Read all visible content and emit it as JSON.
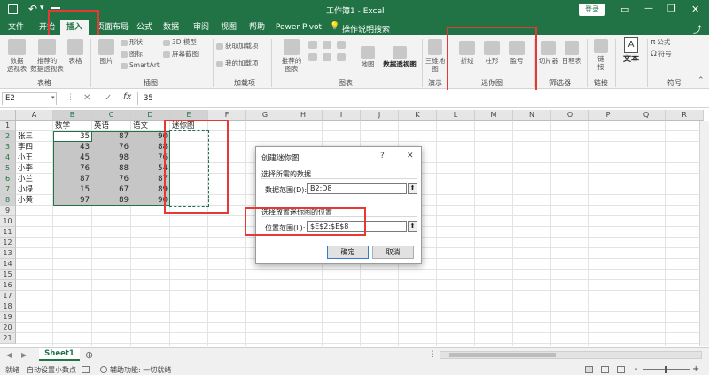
{
  "titlebar": {
    "qat_undo": "↶",
    "qat_dropdown": "▾",
    "title": "工作簿1 - Excel",
    "login": "登录",
    "ribbon_opts": "▭",
    "minimize": "—",
    "restore": "❐",
    "close": "✕"
  },
  "tabs": [
    {
      "label": "文件"
    },
    {
      "label": "开始"
    },
    {
      "label": "插入"
    },
    {
      "label": "页面布局"
    },
    {
      "label": "公式"
    },
    {
      "label": "数据"
    },
    {
      "label": "审阅"
    },
    {
      "label": "视图"
    },
    {
      "label": "帮助"
    },
    {
      "label": "Power Pivot"
    }
  ],
  "tell_me": {
    "icon": "💡",
    "label": "操作说明搜索"
  },
  "share": "⤴",
  "ribbon": {
    "table_group": {
      "pivot": "数据\n透视表",
      "recommended_pivot": "推荐的\n数据透视表",
      "table": "表格",
      "label": "表格"
    },
    "illus_group": {
      "pictures": "图片",
      "shapes": "形状",
      "icons": "图标",
      "model3d": "3D 模型",
      "smartart": "SmartArt",
      "screenshot": "屏幕截图",
      "label": "插图"
    },
    "addins_group": {
      "get": "获取加载项",
      "my": "我的加载项",
      "label": "加载项"
    },
    "charts_group": {
      "recommended": "推荐的\n图表",
      "maps": "地图",
      "pivotchart": "数据透视图",
      "label": "图表"
    },
    "tours_group": {
      "map3d": "三维地\n图",
      "label": "演示"
    },
    "sparkline_group": {
      "line": "折线",
      "column": "柱形",
      "winloss": "盈亏",
      "label": "迷你图"
    },
    "filter_group": {
      "slicer": "切片器",
      "timeline": "日程表",
      "label": "筛选器"
    },
    "links_group": {
      "link": "链\n接",
      "label": "链接"
    },
    "text_group": {
      "text": "文本",
      "label": ""
    },
    "symbols_group": {
      "equation": "公式",
      "symbol": "符号",
      "label": "符号"
    },
    "collapse": "⌃"
  },
  "formula_bar": {
    "name_box": "E2",
    "cancel": "✕",
    "enter": "✓",
    "fx": "fx",
    "value": "35"
  },
  "sheet": {
    "columns": [
      "A",
      "B",
      "C",
      "D",
      "E",
      "F",
      "G",
      "H",
      "I",
      "J",
      "K",
      "L",
      "M",
      "N",
      "O",
      "P",
      "Q",
      "R"
    ],
    "rows": [
      "1",
      "2",
      "3",
      "4",
      "5",
      "6",
      "7",
      "8",
      "9",
      "10",
      "11",
      "12",
      "13",
      "14",
      "15",
      "16",
      "17",
      "18",
      "19",
      "20",
      "21"
    ],
    "headers": [
      "数学",
      "英语",
      "语文",
      "迷你图"
    ],
    "data": [
      {
        "name": "张三",
        "math": "35",
        "english": "87",
        "chinese": "90"
      },
      {
        "name": "李四",
        "math": "43",
        "english": "76",
        "chinese": "88"
      },
      {
        "name": "小王",
        "math": "45",
        "english": "98",
        "chinese": "76"
      },
      {
        "name": "小李",
        "math": "76",
        "english": "88",
        "chinese": "54"
      },
      {
        "name": "小兰",
        "math": "87",
        "english": "76",
        "chinese": "87"
      },
      {
        "name": "小绿",
        "math": "15",
        "english": "67",
        "chinese": "89"
      },
      {
        "name": "小黄",
        "math": "97",
        "english": "89",
        "chinese": "90"
      }
    ]
  },
  "dialog": {
    "title": "创建迷你图",
    "help": "?",
    "close": "✕",
    "section1": "选择所需的数据",
    "data_range_label": "数据范围(D):",
    "data_range_value": "B2:D8",
    "section2": "选择放置迷你图的位置",
    "location_label": "位置范围(L):",
    "location_value": "$E$2:$E$8",
    "picker": "⬆",
    "ok": "确定",
    "cancel": "取消"
  },
  "sheet_tabs": {
    "prev": "◀",
    "next": "▶",
    "tab": "Sheet1",
    "add": "⊕",
    "more": "⋮"
  },
  "status_bar": {
    "ready": "就绪",
    "auto_decimal": "自动设置小数点",
    "accessibility": "辅助功能: 一切就绪",
    "zoom_minus": "-",
    "zoom_plus": "+"
  },
  "colors": {
    "brand": "#217346",
    "highlight": "#e53935",
    "selected_fill": "#c6c6c6"
  }
}
